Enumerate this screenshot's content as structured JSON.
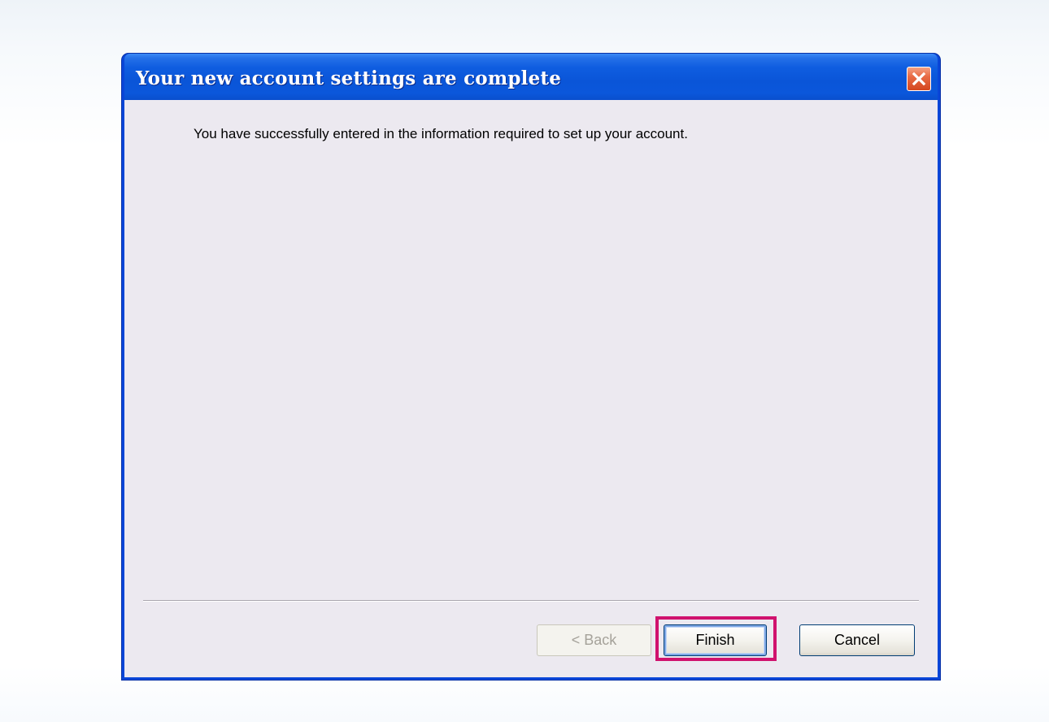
{
  "dialog": {
    "title": "Your new account settings are complete",
    "message": "You have successfully entered in the information required to set up your account.",
    "close_icon": "close-icon",
    "buttons": {
      "back_label": "< Back",
      "back_enabled": false,
      "finish_label": "Finish",
      "cancel_label": "Cancel"
    },
    "highlight": {
      "target": "finish-button",
      "color": "#d0126e"
    }
  },
  "colors": {
    "titlebar": "#0a55d8",
    "client_background": "#ece9f0",
    "close_button": "#e86b45"
  }
}
